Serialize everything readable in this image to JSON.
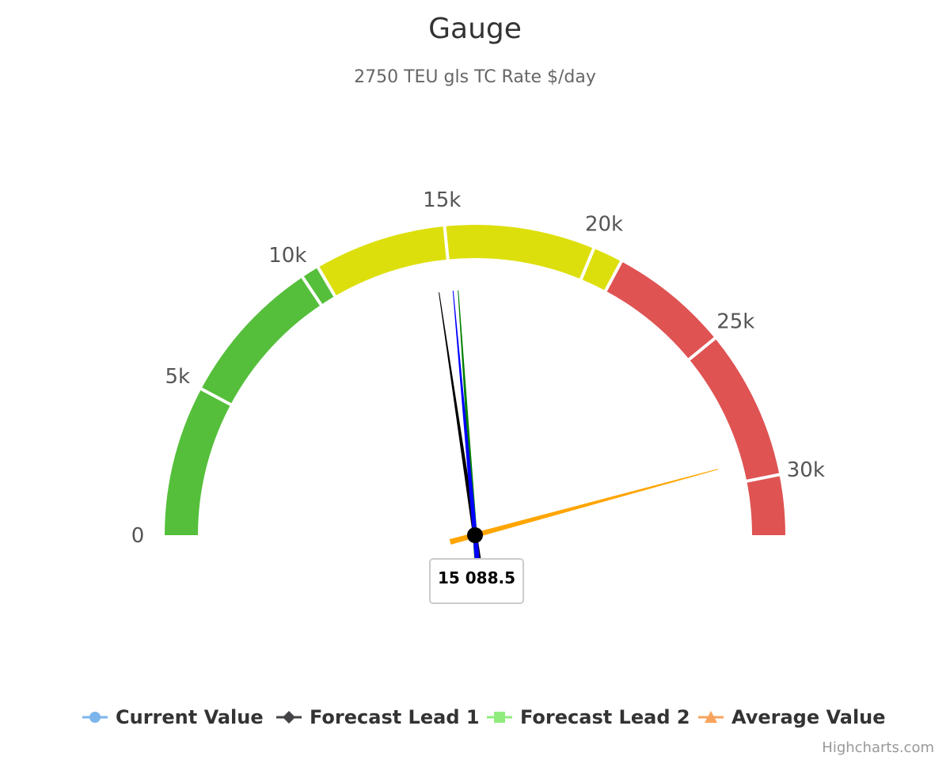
{
  "chart_data": {
    "type": "gauge",
    "title": "Gauge",
    "subtitle": "2750 TEU gls TC Rate $/day",
    "axis": {
      "min": 0,
      "max": 32000,
      "start_angle_deg": -90,
      "end_angle_deg": 90,
      "tick_values": [
        0,
        5000,
        10000,
        15000,
        20000,
        25000,
        30000
      ],
      "tick_labels": [
        "0",
        "5k",
        "10k",
        "15k",
        "20k",
        "25k",
        "30k"
      ]
    },
    "bands": [
      {
        "from": 0,
        "to": 10600,
        "color": "#55BF3B"
      },
      {
        "from": 10600,
        "to": 21000,
        "color": "#DDDF0D"
      },
      {
        "from": 21000,
        "to": 32000,
        "color": "#DF5353"
      }
    ],
    "series": [
      {
        "name": "Current Value",
        "value": 15088.5,
        "needle_color": "#0000FF",
        "legend_color": "#7CB5EC",
        "legend_marker": "circle"
      },
      {
        "name": "Forecast Lead 1",
        "value": 14500,
        "needle_color": "#000000",
        "legend_color": "#434348",
        "legend_marker": "diamond"
      },
      {
        "name": "Forecast Lead 2",
        "value": 15300,
        "needle_color": "#008000",
        "legend_color": "#90ED7D",
        "legend_marker": "square"
      },
      {
        "name": "Average Value",
        "value": 29300,
        "needle_color": "#FFA500",
        "legend_color": "#F7A35C",
        "legend_marker": "triangle"
      }
    ],
    "data_label": "15 088.5",
    "legend_position": "bottom-center"
  },
  "credits": "Highcharts.com"
}
